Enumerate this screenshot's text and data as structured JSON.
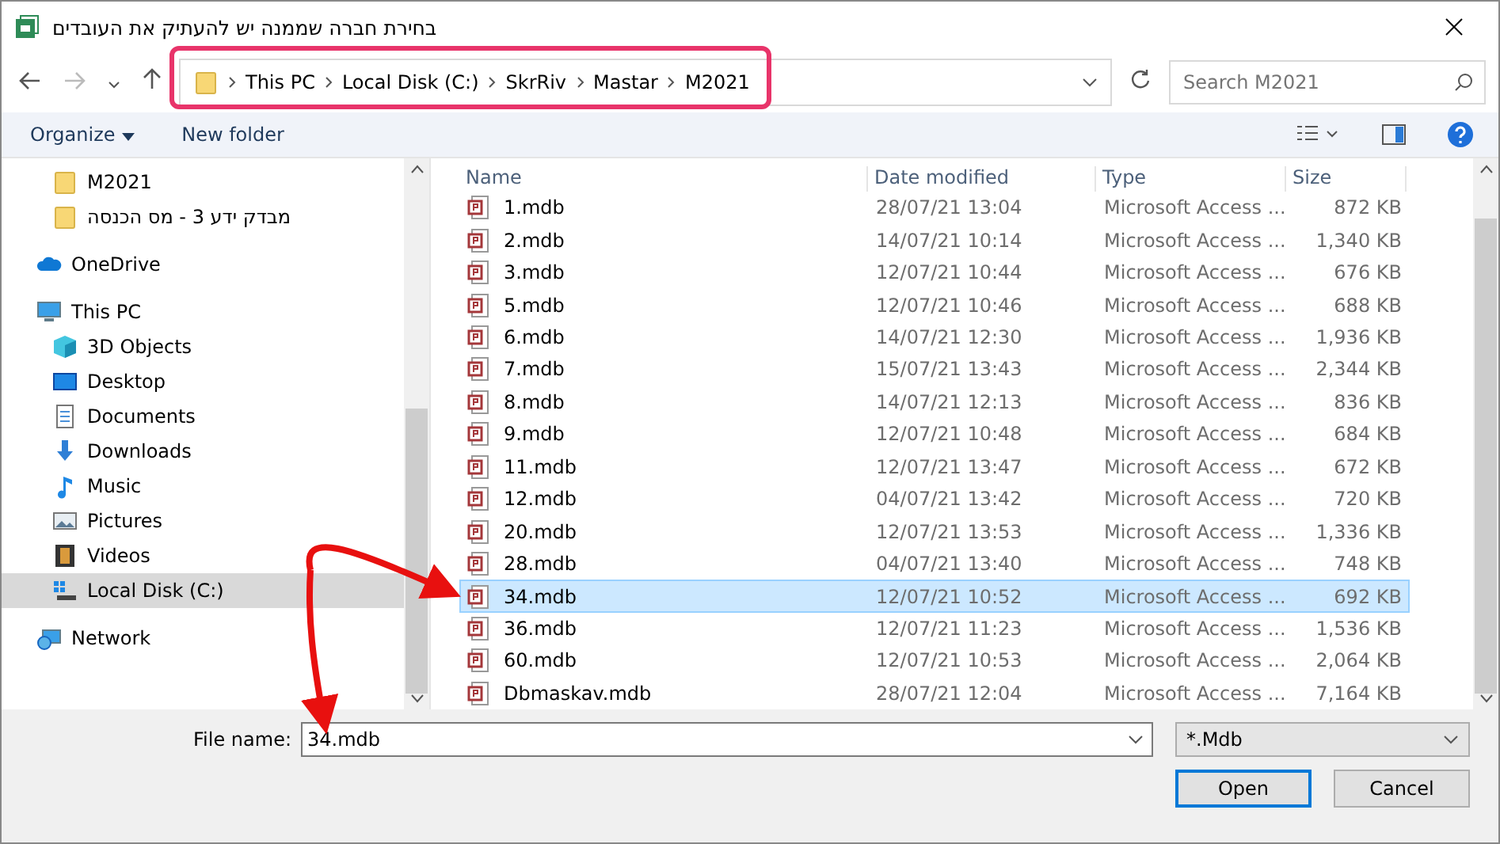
{
  "window": {
    "title": "בחירת חברה שממנה יש להעתיק את העובדים"
  },
  "address": {
    "breadcrumbs": [
      "This PC",
      "Local Disk (C:)",
      "SkrRiv",
      "Mastar",
      "M2021"
    ],
    "highlighted": true
  },
  "search": {
    "placeholder": "Search M2021"
  },
  "toolbar": {
    "organize": "Organize",
    "new_folder": "New folder"
  },
  "nav": [
    {
      "label": "M2021",
      "kind": "folder",
      "selected": false
    },
    {
      "label": "מבדק ידע 3 - מס הכנסה",
      "kind": "folder",
      "selected": false
    },
    {
      "label": "OneDrive",
      "kind": "cloud",
      "selected": false
    },
    {
      "label": "This PC",
      "kind": "pc",
      "selected": false,
      "children": [
        {
          "label": "3D Objects",
          "kind": "cube",
          "selected": false
        },
        {
          "label": "Desktop",
          "kind": "desktop",
          "selected": false
        },
        {
          "label": "Documents",
          "kind": "document",
          "selected": false
        },
        {
          "label": "Downloads",
          "kind": "download",
          "selected": false
        },
        {
          "label": "Music",
          "kind": "music",
          "selected": false
        },
        {
          "label": "Pictures",
          "kind": "picture",
          "selected": false
        },
        {
          "label": "Videos",
          "kind": "video",
          "selected": false
        },
        {
          "label": "Local Disk (C:)",
          "kind": "drive",
          "selected": true
        }
      ]
    },
    {
      "label": "Network",
      "kind": "network",
      "selected": false
    }
  ],
  "table": {
    "columns": [
      "Name",
      "Date modified",
      "Type",
      "Size"
    ],
    "rows": [
      {
        "name": "1.mdb",
        "date": "28/07/21 13:04",
        "type": "Microsoft Access ...",
        "size": "872 KB",
        "selected": false
      },
      {
        "name": "2.mdb",
        "date": "14/07/21 10:14",
        "type": "Microsoft Access ...",
        "size": "1,340 KB",
        "selected": false
      },
      {
        "name": "3.mdb",
        "date": "12/07/21 10:44",
        "type": "Microsoft Access ...",
        "size": "676 KB",
        "selected": false
      },
      {
        "name": "5.mdb",
        "date": "12/07/21 10:46",
        "type": "Microsoft Access ...",
        "size": "688 KB",
        "selected": false
      },
      {
        "name": "6.mdb",
        "date": "14/07/21 12:30",
        "type": "Microsoft Access ...",
        "size": "1,936 KB",
        "selected": false
      },
      {
        "name": "7.mdb",
        "date": "15/07/21 13:43",
        "type": "Microsoft Access ...",
        "size": "2,344 KB",
        "selected": false
      },
      {
        "name": "8.mdb",
        "date": "14/07/21 12:13",
        "type": "Microsoft Access ...",
        "size": "836 KB",
        "selected": false
      },
      {
        "name": "9.mdb",
        "date": "12/07/21 10:48",
        "type": "Microsoft Access ...",
        "size": "684 KB",
        "selected": false
      },
      {
        "name": "11.mdb",
        "date": "12/07/21 13:47",
        "type": "Microsoft Access ...",
        "size": "672 KB",
        "selected": false
      },
      {
        "name": "12.mdb",
        "date": "04/07/21 13:42",
        "type": "Microsoft Access ...",
        "size": "720 KB",
        "selected": false
      },
      {
        "name": "20.mdb",
        "date": "12/07/21 13:53",
        "type": "Microsoft Access ...",
        "size": "1,336 KB",
        "selected": false
      },
      {
        "name": "28.mdb",
        "date": "04/07/21 13:40",
        "type": "Microsoft Access ...",
        "size": "748 KB",
        "selected": false
      },
      {
        "name": "34.mdb",
        "date": "12/07/21 10:52",
        "type": "Microsoft Access ...",
        "size": "692 KB",
        "selected": true
      },
      {
        "name": "36.mdb",
        "date": "12/07/21 11:23",
        "type": "Microsoft Access ...",
        "size": "1,536 KB",
        "selected": false
      },
      {
        "name": "60.mdb",
        "date": "12/07/21 10:53",
        "type": "Microsoft Access ...",
        "size": "2,064 KB",
        "selected": false
      },
      {
        "name": "Dbmaskav.mdb",
        "date": "28/07/21 12:04",
        "type": "Microsoft Access ...",
        "size": "7,164 KB",
        "selected": false
      }
    ]
  },
  "file_name": {
    "label": "File name:",
    "value": "34.mdb"
  },
  "filter": {
    "value": "*.Mdb"
  },
  "buttons": [
    "Open",
    "Cancel"
  ]
}
